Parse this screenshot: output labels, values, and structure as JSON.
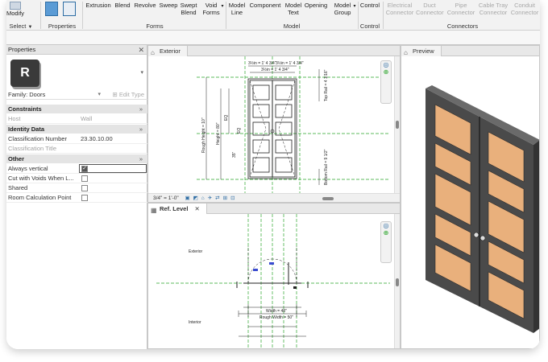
{
  "ribbon": {
    "buttons": [
      {
        "label": "Modify",
        "enabled": true
      },
      {
        "label": "Extrusion",
        "enabled": true
      },
      {
        "label": "Blend",
        "enabled": true
      },
      {
        "label": "Revolve",
        "enabled": true
      },
      {
        "label": "Sweep",
        "enabled": true
      },
      {
        "label": "Swept Blend",
        "enabled": true
      },
      {
        "label": "Void Forms",
        "enabled": true
      },
      {
        "label": "Model Line",
        "enabled": true
      },
      {
        "label": "Component",
        "enabled": true
      },
      {
        "label": "Model Text",
        "enabled": true
      },
      {
        "label": "Opening",
        "enabled": true
      },
      {
        "label": "Model Group",
        "enabled": true
      },
      {
        "label": "Control",
        "enabled": true
      },
      {
        "label": "Electrical Connector",
        "enabled": false
      },
      {
        "label": "Duct Connector",
        "enabled": false
      },
      {
        "label": "Pipe Connector",
        "enabled": false
      },
      {
        "label": "Cable Tray Connector",
        "enabled": false
      },
      {
        "label": "Conduit Connector",
        "enabled": false
      }
    ],
    "groups": {
      "select": "Select",
      "properties": "Properties",
      "forms": "Forms",
      "model": "Model",
      "control": "Control",
      "connectors": "Connectors"
    }
  },
  "properties_panel": {
    "title": "Properties",
    "type_icon_letter": "R",
    "family": "Family: Doors",
    "edit_type": "Edit Type",
    "sections": {
      "constraints": "Constraints",
      "identity": "Identity Data",
      "other": "Other"
    },
    "section_marker": "»",
    "rows": {
      "host": {
        "label": "Host",
        "value": "Wall"
      },
      "classification_number": {
        "label": "Classification Number",
        "value": "23.30.10.00"
      },
      "classification_title": {
        "label": "Classification Title",
        "value": ""
      },
      "always_vertical": {
        "label": "Always vertical",
        "checked": true
      },
      "cut_with_voids": {
        "label": "Cut with Voids When L...",
        "checked": false
      },
      "shared": {
        "label": "Shared",
        "checked": false
      },
      "room_calc_point": {
        "label": "Room Calculation Point",
        "checked": false
      }
    }
  },
  "views": {
    "exterior": {
      "tab": "Exterior",
      "scale": "3/4\" = 1'-0\"",
      "dims": {
        "top_left": "3½in = 1' 4 3/4\"",
        "top_right": "3½in = 1' 4 3/4\"",
        "top_center": "3½in = 1' 4 3/4\"",
        "rough_height": "Rough Height = 10\"",
        "height": "Height = 80\"",
        "eq": "EQ",
        "eq_left": "EQ",
        "thirty_five": "35\"",
        "top_rail": "Top Rail = 4 1/16\"",
        "bottom_rail": "Bottom Rail = 9 1/2\""
      }
    },
    "ref_level": {
      "tab": "Ref. Level",
      "labels": {
        "exterior": "Exterior",
        "interior": "Interior",
        "width": "Width = 48\"",
        "rough_width": "Rough Width = 50\""
      }
    },
    "preview": {
      "tab": "Preview",
      "door_frame_color": "#4a4a4a",
      "panel_color": "#e9b07c"
    }
  }
}
